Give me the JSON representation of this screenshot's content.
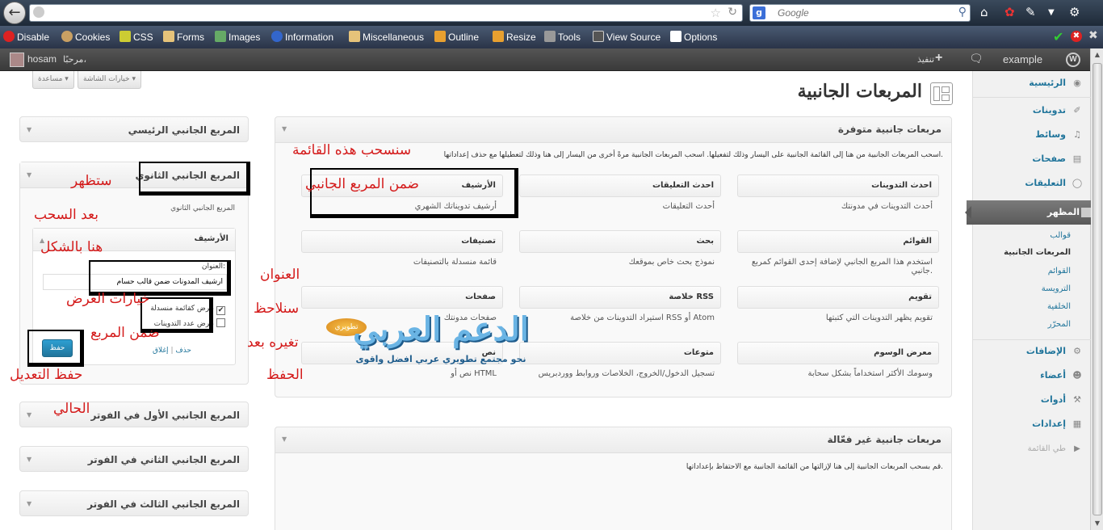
{
  "browser": {
    "search_placeholder": "Google"
  },
  "devtoolbar": {
    "items": [
      "Disable",
      "Cookies",
      "CSS",
      "Forms",
      "Images",
      "Information",
      "Miscellaneous",
      "Outline",
      "Resize",
      "Tools",
      "View Source",
      "Options"
    ]
  },
  "adminbar": {
    "site_name": "example",
    "new_label": "تنفيذ",
    "greeting": "مرحبًا،",
    "username": "hosam"
  },
  "menu": {
    "home": "الرئيسية",
    "posts": "تدوينات",
    "media": "وسائط",
    "pages": "صفحات",
    "comments": "التعليقات",
    "appearance": "المظهر",
    "sub": [
      "قوالب",
      "المربعات الجانبية",
      "القوائم",
      "الترويسة",
      "الخلفية",
      "المحرّر"
    ],
    "plugins": "الإضافات",
    "users": "أعضاء",
    "tools": "أدوات",
    "settings": "إعدادات",
    "collapse": "طي القائمة"
  },
  "screen": {
    "options": "خيارات الشاشة",
    "help": "مساعدة"
  },
  "page_title": "المربعات الجانبية",
  "available": {
    "title": "مربعات جانبية متوفرة",
    "description": "اسحب المربعات الجانبية من هنا إلى القائمة الجانبية على اليسار وذلك لتفعيلها. اسحب المربعات الجانبية مرةً أخرى من اليسار إلى هنا وذلك لتعطيلها مع حذف إعداداتها.",
    "widgets": [
      {
        "name": "احدث التدوينات",
        "desc": "أحدث التدوينات في مدونتك"
      },
      {
        "name": "احدث التعليقات",
        "desc": "أحدث التعليقات"
      },
      {
        "name": "الأرشيف",
        "desc": "أرشيف تدويناتك الشهري"
      },
      {
        "name": "القوائم",
        "desc": "استخدم هذا المربع الجانبي لإضافة إحدى القوائم كمربع جانبي."
      },
      {
        "name": "بحث",
        "desc": "نموذج بحث خاص بموقعك"
      },
      {
        "name": "تصنيفات",
        "desc": "قائمة منسدلة بالتصنيفات"
      },
      {
        "name": "تقويم",
        "desc": "تقويم يظهر التدوينات التي كتبتها"
      },
      {
        "name": "خلاصة RSS",
        "desc": "استيراد التدوينات من خلاصة RSS أو Atom"
      },
      {
        "name": "صفحات",
        "desc": "صفحات مدونتك"
      },
      {
        "name": "معرض الوسوم",
        "desc": "وسومك الأكثر استخداماً بشكل سحابة"
      },
      {
        "name": "متوعات",
        "desc": "تسجيل الدخول/الخروج، الخلاصات وروابط ووردبريس"
      },
      {
        "name": "نص",
        "desc": "نص أو HTML"
      }
    ]
  },
  "inactive": {
    "title": "مربعات جانبية غير فعّالة",
    "description": "قم بسحب المربعات الجانبية إلى هنا لإزالتها من القائمة الجانبية مع الاحتفاظ بإعداداتها."
  },
  "sidebars": {
    "main": "المربع الجانبي الرئيسي",
    "secondary": "المربع الجانبي الثانوي",
    "secondary_desc": "المربع الجانبي الثانوي",
    "footer1": "المربع الجانبي الأول في الفوتر",
    "footer2": "المربع الجانبي الثاني في الفوتر",
    "footer3": "المربع الجانبي الثالث في الفوتر"
  },
  "archive_widget": {
    "title": "الأرشيف",
    "title_label": "العنوان:",
    "title_value": "أرشيف المدونات ضمن قالب حسام",
    "opt_dropdown": "عرض كقائمة منسدلة",
    "opt_count": "عرض عدد التدوينات",
    "delete": "حذف",
    "close": "إغلاق",
    "separator": "|",
    "save": "حفظ"
  },
  "annotations": {
    "a1": "سنسحب هذه القائمة",
    "a2": "ضمن المربع الجانبي",
    "a3": "ستظهر",
    "a4": "بعد السحب",
    "a5": "هنا بالشكل",
    "a6": "العنوان",
    "a7": "خيارات العرض",
    "a8": "سنلاحظ",
    "a9": "ضمن المربع",
    "a10": "تغيره بعد",
    "a11": "الحفظ",
    "a12": "حفظ التعديل",
    "a13": "الحالي"
  },
  "watermark": {
    "main": "الدعم العربي",
    "sub": "نحو مجتمع تطويري عربي افضل واقوى",
    "badge": "تطويري"
  }
}
